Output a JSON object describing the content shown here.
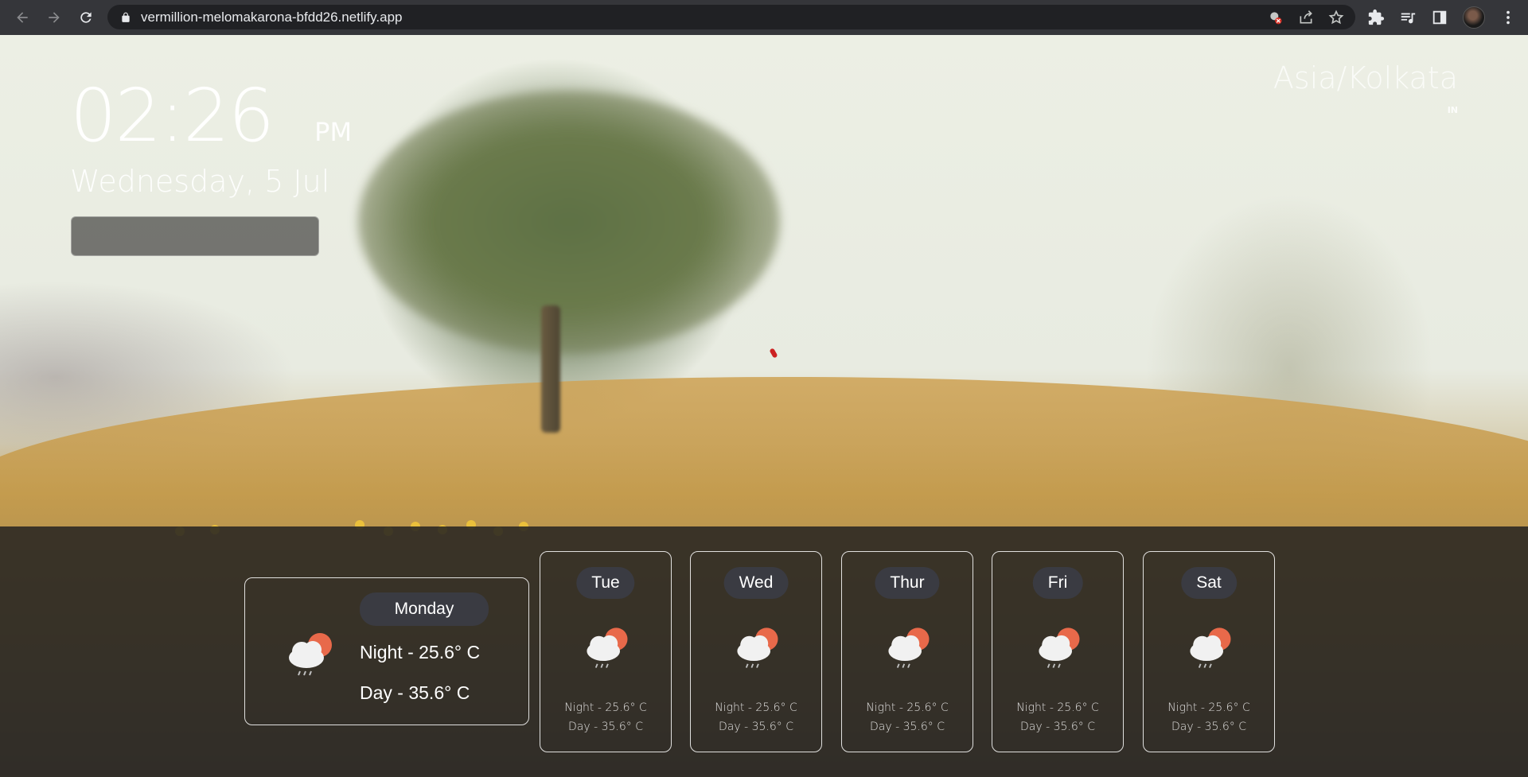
{
  "browser": {
    "url": "vermillion-melomakarona-bfdd26.netlify.app",
    "icons": [
      "back-icon",
      "forward-icon",
      "reload-icon",
      "lock-icon",
      "blocked-camera-icon",
      "share-icon",
      "star-icon",
      "extensions-icon",
      "media-icon",
      "sidepanel-icon",
      "profile-avatar",
      "menu-icon"
    ]
  },
  "clock": {
    "time": "02:26",
    "ampm": "PM",
    "date": "Wednesday, 5 Jul"
  },
  "location": {
    "timezone": "Asia/Kolkata",
    "country": "IN"
  },
  "today": {
    "label": "Monday",
    "night": "Night - 25.6° C",
    "day": "Day - 35.6° C",
    "icon": "cloud-sun-rain-icon"
  },
  "forecast": [
    {
      "label": "Tue",
      "night": "Night - 25.6° C",
      "day": "Day - 35.6° C"
    },
    {
      "label": "Wed",
      "night": "Night - 25.6° C",
      "day": "Day - 35.6° C"
    },
    {
      "label": "Thur",
      "night": "Night - 25.6° C",
      "day": "Day - 35.6° C"
    },
    {
      "label": "Fri",
      "night": "Night - 25.6° C",
      "day": "Day - 35.6° C"
    },
    {
      "label": "Sat",
      "night": "Night - 25.6° C",
      "day": "Day - 35.6° C"
    }
  ],
  "colors": {
    "chrome_bg": "#35363a",
    "omnibox_bg": "#202124",
    "pill_bg": "#3a3b42",
    "sun": "#e8694a",
    "panel_bg": "#28261f"
  }
}
